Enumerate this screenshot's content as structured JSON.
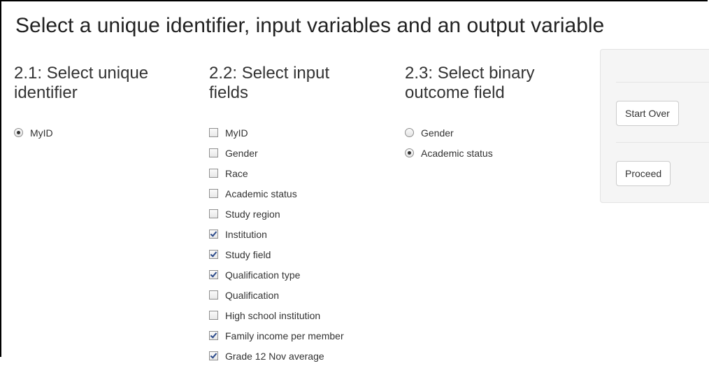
{
  "title": "Select a unique identifier, input variables and an output variable",
  "identifier": {
    "heading": "2.1: Select unique\nidentifier",
    "options": [
      {
        "label": "MyID",
        "selected": true
      }
    ]
  },
  "inputs": {
    "heading": "2.2: Select input\nfields",
    "options": [
      {
        "label": "MyID",
        "checked": false
      },
      {
        "label": "Gender",
        "checked": false
      },
      {
        "label": "Race",
        "checked": false
      },
      {
        "label": "Academic status",
        "checked": false
      },
      {
        "label": "Study region",
        "checked": false
      },
      {
        "label": "Institution",
        "checked": true
      },
      {
        "label": "Study field",
        "checked": true
      },
      {
        "label": "Qualification type",
        "checked": true
      },
      {
        "label": "Qualification",
        "checked": false
      },
      {
        "label": "High school institution",
        "checked": false
      },
      {
        "label": "Family income per member",
        "checked": true
      },
      {
        "label": "Grade 12 Nov average",
        "checked": true
      }
    ]
  },
  "outcome": {
    "heading": "2.3: Select binary\noutcome field",
    "options": [
      {
        "label": "Gender",
        "selected": false
      },
      {
        "label": "Academic status",
        "selected": true
      }
    ]
  },
  "actions": {
    "start_over_label": "Start Over",
    "proceed_label": "Proceed"
  }
}
